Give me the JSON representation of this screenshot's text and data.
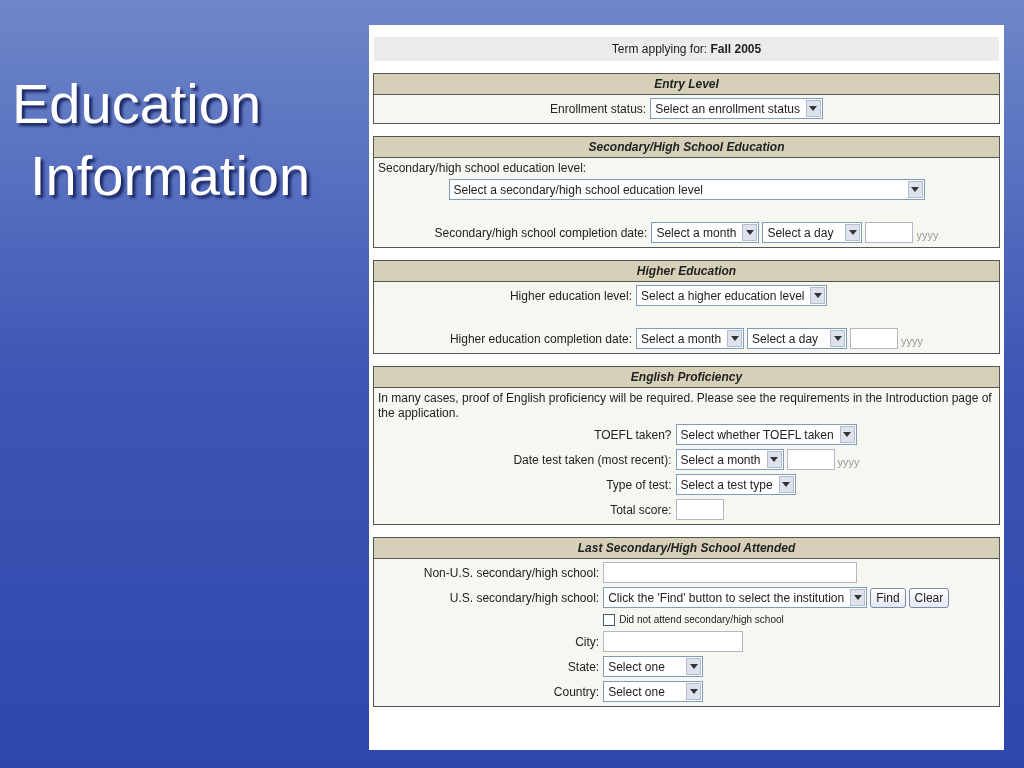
{
  "slide": {
    "title_lines": [
      "Education",
      "Information"
    ]
  },
  "form": {
    "term": {
      "label": "Term applying for:",
      "value": "Fall 2005"
    },
    "sections": [
      {
        "title": "Entry Level",
        "rows": [
          {
            "kind": "field",
            "label": "Enrollment status:",
            "controls": [
              {
                "kind": "select",
                "value": "Select an enrollment status"
              }
            ]
          }
        ]
      },
      {
        "title": "Secondary/High School Education",
        "rows": [
          {
            "kind": "note",
            "text": "Secondary/high school education level:"
          },
          {
            "kind": "wide",
            "controls": [
              {
                "kind": "select",
                "value": "Select a secondary/high school education level"
              }
            ]
          },
          {
            "kind": "field",
            "label": "Secondary/high school completion date:",
            "controls": [
              {
                "kind": "select",
                "value": "Select a month"
              },
              {
                "kind": "select",
                "value": "Select a day"
              },
              {
                "kind": "input"
              },
              {
                "kind": "hint",
                "text": "yyyy"
              }
            ]
          }
        ]
      },
      {
        "title": "Higher Education",
        "rows": [
          {
            "kind": "field",
            "label": "Higher education level:",
            "controls": [
              {
                "kind": "select",
                "value": "Select a higher education level"
              }
            ]
          },
          {
            "kind": "field",
            "label": "Higher education completion date:",
            "controls": [
              {
                "kind": "select",
                "value": "Select a month"
              },
              {
                "kind": "select",
                "value": "Select a day"
              },
              {
                "kind": "input"
              },
              {
                "kind": "hint",
                "text": "yyyy"
              }
            ]
          }
        ]
      },
      {
        "title": "English Proficiency",
        "rows": [
          {
            "kind": "note",
            "text": "In many cases, proof of English proficiency will be required. Please see the requirements in the Introduction page of the application."
          },
          {
            "kind": "field",
            "label": "TOEFL taken?",
            "controls": [
              {
                "kind": "select",
                "value": "Select whether TOEFL taken"
              }
            ]
          },
          {
            "kind": "field",
            "label": "Date test taken (most recent):",
            "controls": [
              {
                "kind": "select",
                "value": "Select a month"
              },
              {
                "kind": "input"
              },
              {
                "kind": "hint",
                "text": "yyyy"
              }
            ]
          },
          {
            "kind": "field",
            "label": "Type of test:",
            "controls": [
              {
                "kind": "select",
                "value": "Select a test type"
              }
            ]
          },
          {
            "kind": "field",
            "label": "Total score:",
            "controls": [
              {
                "kind": "input"
              }
            ]
          }
        ]
      },
      {
        "title": "Last Secondary/High School Attended",
        "rows": [
          {
            "kind": "field",
            "label": "Non-U.S. secondary/high school:",
            "controls": [
              {
                "kind": "input_long"
              }
            ]
          },
          {
            "kind": "field",
            "label": "U.S. secondary/high school:",
            "controls": [
              {
                "kind": "select",
                "value": "Click the 'Find' button to select the institution"
              },
              {
                "kind": "button",
                "text": "Find"
              },
              {
                "kind": "button",
                "text": "Clear"
              }
            ]
          },
          {
            "kind": "field",
            "controls": [
              {
                "kind": "checkbox",
                "text": "Did not attend secondary/high school",
                "checked": false
              }
            ]
          },
          {
            "kind": "field",
            "label": "City:",
            "controls": [
              {
                "kind": "input_mid"
              }
            ]
          },
          {
            "kind": "field",
            "label": "State:",
            "controls": [
              {
                "kind": "select",
                "value": "Select one"
              }
            ]
          },
          {
            "kind": "field",
            "label": "Country:",
            "controls": [
              {
                "kind": "select",
                "value": "Select one"
              }
            ]
          }
        ]
      }
    ]
  }
}
